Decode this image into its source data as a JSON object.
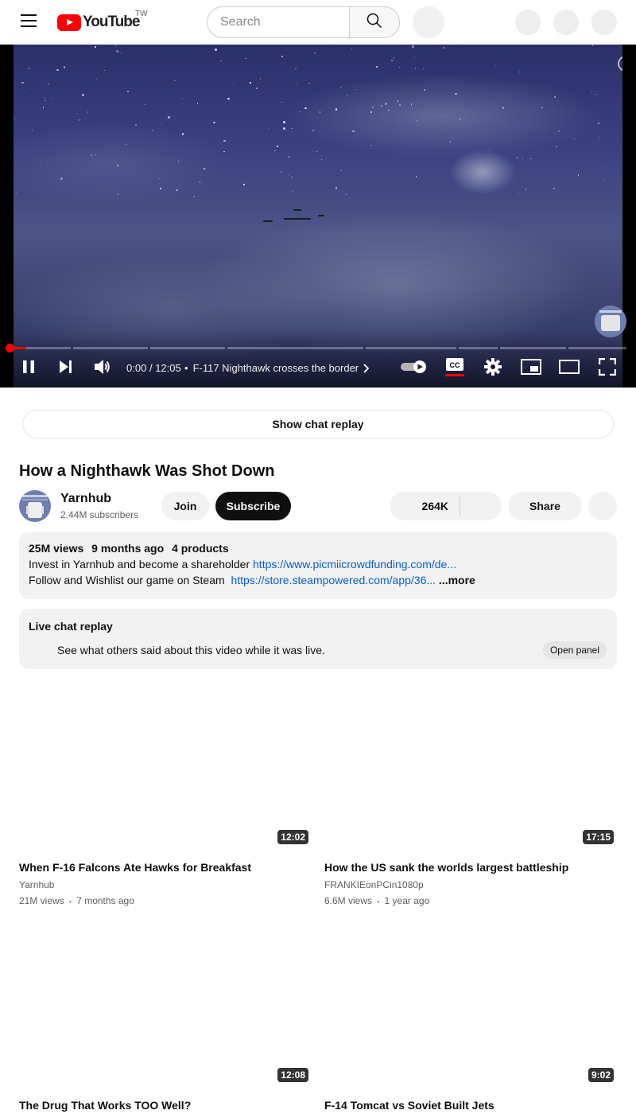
{
  "masthead": {
    "logo_text": "YouTube",
    "region": "TW",
    "search_placeholder": "Search"
  },
  "player": {
    "time_current": "0:00",
    "time_total": "12:05",
    "time_separator": "/",
    "chapter_dot": "•",
    "chapter_title": "F-117 Nighthawk crosses the border",
    "progress_played_fraction": 0.027,
    "autoplay_on": true,
    "captions_on": true,
    "accent_color": "#ff0000"
  },
  "chat_replay_button": "Show chat replay",
  "video": {
    "title": "How a Nighthawk Was Shot Down",
    "channel": "Yarnhub",
    "subscribers": "2.44M subscribers",
    "join_label": "Join",
    "subscribe_label": "Subscribe",
    "likes": "264K",
    "share_label": "Share"
  },
  "description": {
    "views": "25M views",
    "age": "9 months ago",
    "products": "4 products",
    "line1_text": "Invest in Yarnhub and become a shareholder ",
    "line1_link": "https://www.picmiicrowdfunding.com/de...",
    "line2_text": "Follow and Wishlist our game on Steam  ",
    "line2_link": "https://store.steampowered.com/app/36...",
    "more_label": "...more"
  },
  "live_chat": {
    "title": "Live chat replay",
    "subtitle": "See what others said about this video while it was live.",
    "open_label": "Open panel"
  },
  "recommendations": [
    {
      "title": "When F-16 Falcons Ate Hawks for Breakfast",
      "channel": "Yarnhub",
      "views": "21M views",
      "age": "7 months ago",
      "duration": "12:02"
    },
    {
      "title": "How the US sank the worlds largest battleship",
      "channel": "FRANKIEonPCin1080p",
      "views": "6.6M views",
      "age": "1 year ago",
      "duration": "17:15"
    },
    {
      "title": "The Drug That Works TOO Well?",
      "channel": "",
      "views": "",
      "age": "",
      "duration": "12:08"
    },
    {
      "title": "F-14 Tomcat vs Soviet Built Jets",
      "channel": "",
      "views": "",
      "age": "",
      "duration": "9:02"
    }
  ],
  "meta_separator": "•",
  "icons": {
    "menu": "menu-icon",
    "search": "search-icon",
    "play_pause": "pause-icon",
    "next": "next-icon",
    "volume": "volume-icon",
    "autoplay": "autoplay-toggle-icon",
    "captions": "captions-icon",
    "settings": "gear-icon",
    "miniplayer": "miniplayer-icon",
    "theater": "theater-mode-icon",
    "fullscreen": "fullscreen-icon",
    "info": "info-icon",
    "chevron": "chevron-right-icon"
  }
}
